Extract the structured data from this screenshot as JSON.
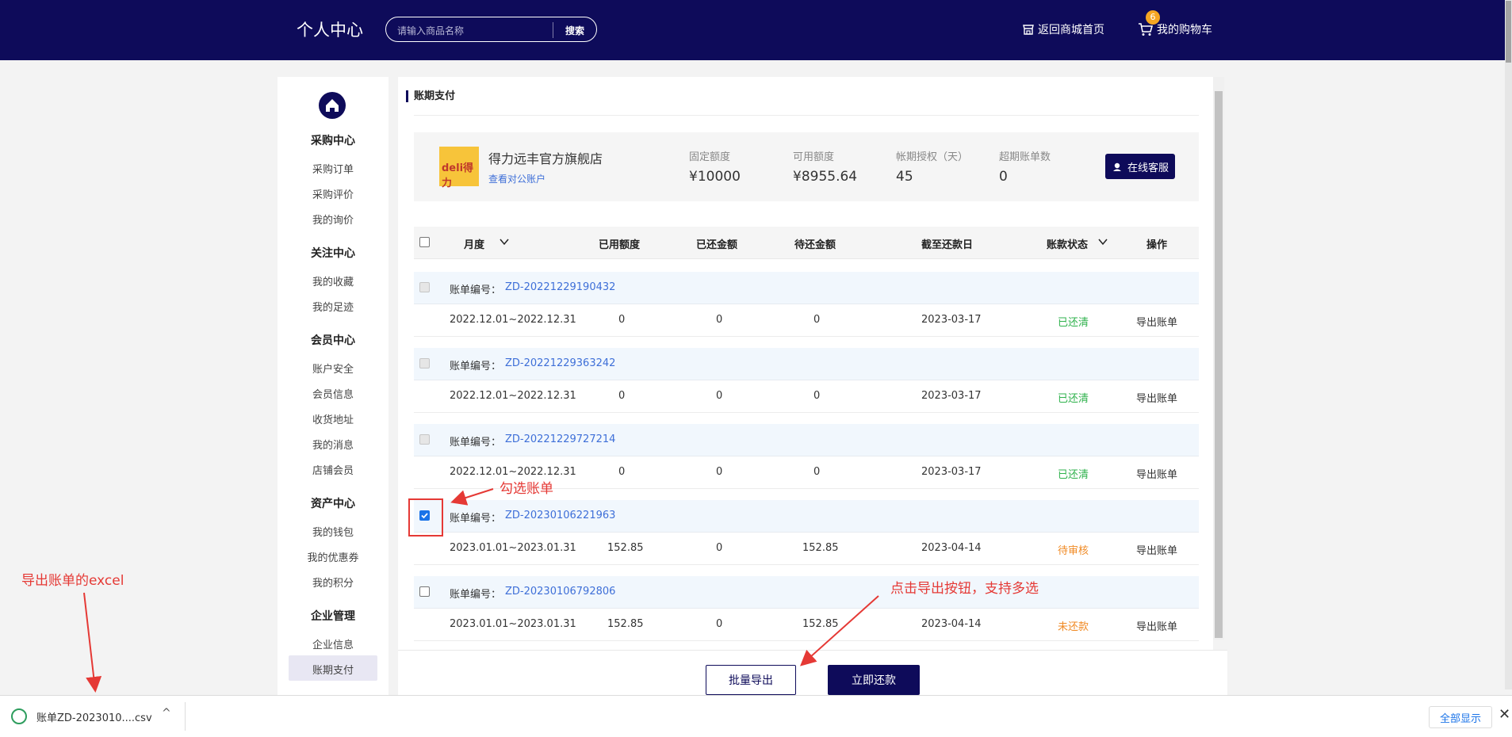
{
  "header": {
    "title": "个人中心",
    "search_placeholder": "请输入商品名称",
    "search_button": "搜索",
    "home_link": "返回商城首页",
    "cart_link": "我的购物车",
    "cart_count": "6"
  },
  "sidebar": {
    "sections": [
      {
        "title": "采购中心",
        "items": [
          "采购订单",
          "采购评价",
          "我的询价"
        ]
      },
      {
        "title": "关注中心",
        "items": [
          "我的收藏",
          "我的足迹"
        ]
      },
      {
        "title": "会员中心",
        "items": [
          "账户安全",
          "会员信息",
          "收货地址",
          "我的消息",
          "店铺会员"
        ]
      },
      {
        "title": "资产中心",
        "items": [
          "我的钱包",
          "我的优惠券",
          "我的积分"
        ]
      },
      {
        "title": "企业管理",
        "items": [
          "企业信息",
          "账期支付"
        ]
      }
    ],
    "active_item": "账期支付"
  },
  "main": {
    "title": "账期支付",
    "shop": {
      "logo_text": "deli得力",
      "name": "得力远丰官方旗舰店",
      "link": "查看对公账户",
      "stats": [
        {
          "label": "固定额度",
          "value": "¥10000"
        },
        {
          "label": "可用额度",
          "value": "¥8955.64"
        },
        {
          "label": "帐期授权（天）",
          "value": "45"
        },
        {
          "label": "超期账单数",
          "value": "0"
        }
      ],
      "service_button": "在线客服"
    },
    "table": {
      "headers": {
        "month": "月度",
        "used": "已用额度",
        "repaid": "已还金额",
        "pending": "待还金额",
        "due": "截至还款日",
        "status": "账款状态",
        "action": "操作"
      },
      "bill_label": "账单编号：",
      "bills": [
        {
          "id": "ZD-20221229190432",
          "period": "2022.12.01~2022.12.31",
          "used": "0",
          "repaid": "0",
          "pending": "0",
          "due": "2023-03-17",
          "status": "已还清",
          "action": "导出账单",
          "checkbox": "disabled"
        },
        {
          "id": "ZD-20221229363242",
          "period": "2022.12.01~2022.12.31",
          "used": "0",
          "repaid": "0",
          "pending": "0",
          "due": "2023-03-17",
          "status": "已还清",
          "action": "导出账单",
          "checkbox": "disabled"
        },
        {
          "id": "ZD-20221229727214",
          "period": "2022.12.01~2022.12.31",
          "used": "0",
          "repaid": "0",
          "pending": "0",
          "due": "2023-03-17",
          "status": "已还清",
          "action": "导出账单",
          "checkbox": "disabled"
        },
        {
          "id": "ZD-20230106221963",
          "period": "2023.01.01~2023.01.31",
          "used": "152.85",
          "repaid": "0",
          "pending": "152.85",
          "due": "2023-04-14",
          "status": "待审核",
          "action": "导出账单",
          "checkbox": "checked"
        },
        {
          "id": "ZD-20230106792806",
          "period": "2023.01.01~2023.01.31",
          "used": "152.85",
          "repaid": "0",
          "pending": "152.85",
          "due": "2023-04-14",
          "status": "未还款",
          "action": "导出账单",
          "checkbox": "unchecked"
        }
      ]
    },
    "footer": {
      "export_button": "批量导出",
      "pay_button": "立即还款"
    }
  },
  "annotations": {
    "select_bill": "勾选账单",
    "click_export": "点击导出按钮，支持多选",
    "export_excel": "导出账单的excel"
  },
  "download_bar": {
    "file_name": "账单ZD-2023010....csv",
    "show_all": "全部显示"
  },
  "colors": {
    "brand": "#0e0b5a",
    "link": "#3e6fd8",
    "paid": "#2fb24c",
    "pending": "#f08a24",
    "annotation": "#e53935"
  }
}
